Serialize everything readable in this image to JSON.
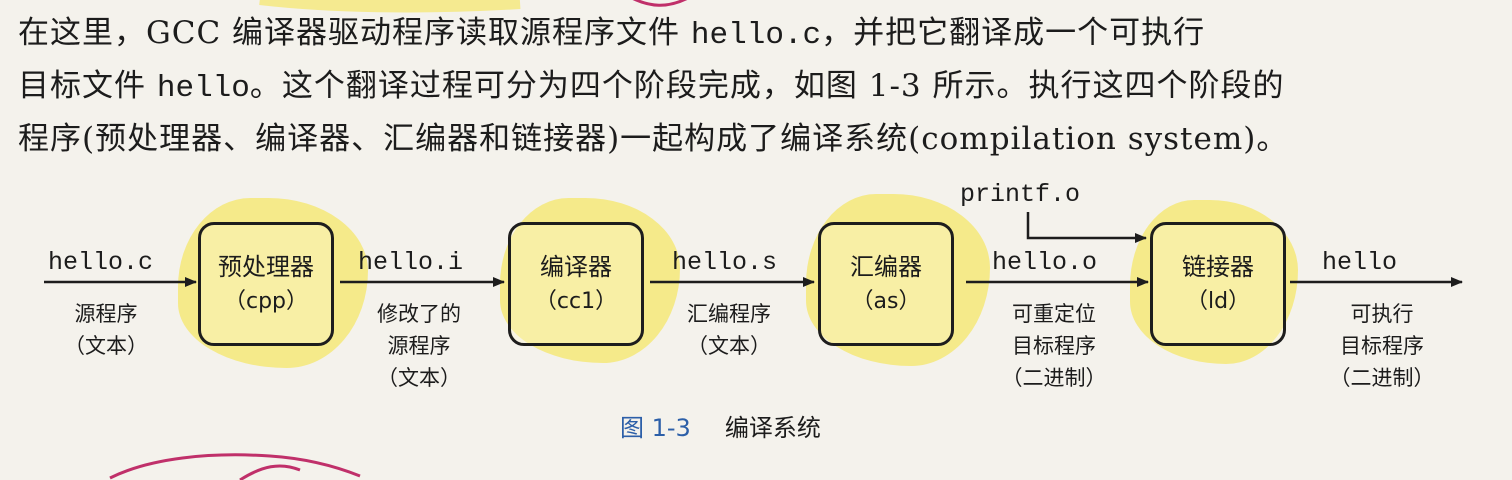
{
  "paragraph": {
    "line1_a": "在这里，GCC 编译器驱动程序读取源程序文件 ",
    "line1_code": "hello.c",
    "line1_b": "，并把它翻译成一个可执行",
    "line2_a": "目标文件 ",
    "line2_code": "hello",
    "line2_b": "。这个翻译过程可分为四个阶段完成，如图 1-3 所示。执行这四个阶段的",
    "line3": "程序(预处理器、编译器、汇编器和链接器)一起构成了编译系统(compilation system)。"
  },
  "figure": {
    "input": {
      "filename": "hello.c",
      "desc": [
        "源程序",
        "（文本）"
      ]
    },
    "stages": [
      {
        "name": "预处理器",
        "code": "（cpp）"
      },
      {
        "name": "编译器",
        "code": "（cc1）"
      },
      {
        "name": "汇编器",
        "code": "（as）"
      },
      {
        "name": "链接器",
        "code": "（ld）"
      }
    ],
    "outputs": [
      {
        "filename": "hello.i",
        "desc": [
          "修改了的",
          "源程序",
          "（文本）"
        ]
      },
      {
        "filename": "hello.s",
        "desc": [
          "汇编程序",
          "（文本）"
        ]
      },
      {
        "filename": "hello.o",
        "desc": [
          "可重定位",
          "目标程序",
          "（二进制）"
        ]
      },
      {
        "filename": "hello",
        "desc": [
          "可执行",
          "目标程序",
          "（二进制）"
        ]
      }
    ],
    "extra_input": "printf.o",
    "caption_number": "图 1-3",
    "caption_title": "编译系统"
  },
  "colors": {
    "highlight": "#f5e76a",
    "ink_annotation": "#c0306a",
    "caption_blue": "#2c5fa8"
  }
}
